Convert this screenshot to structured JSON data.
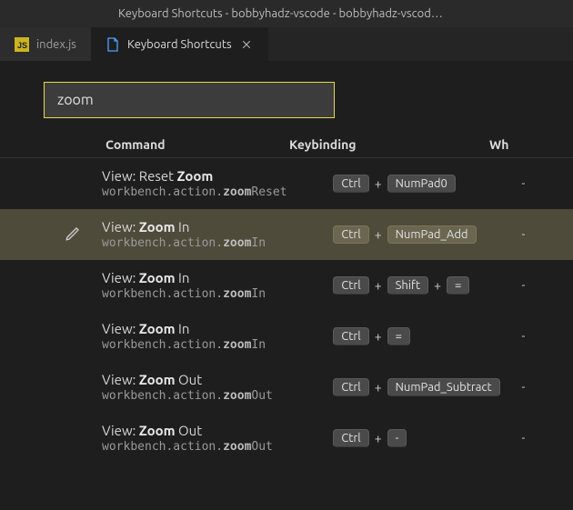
{
  "window": {
    "title": "Keyboard Shortcuts - bobbyhadz-vscode - bobbyhadz-vscod…"
  },
  "tabs": [
    {
      "label": "index.js",
      "icon": "js",
      "active": false,
      "close": false
    },
    {
      "label": "Keyboard Shortcuts",
      "icon": "file",
      "active": true,
      "close": true
    }
  ],
  "search": {
    "value": "zoom"
  },
  "columns": {
    "command": "Command",
    "keybinding": "Keybinding",
    "when": "Wh"
  },
  "rows": [
    {
      "title_pre": "View: Reset ",
      "title_hi": "Zoom",
      "title_post": "",
      "id_pre": "workbench.action.",
      "id_hi": "zoom",
      "id_post": "Reset",
      "k1": "Ctrl",
      "k2": "NumPad0",
      "k3": "",
      "when": "-",
      "selected": false
    },
    {
      "title_pre": "View: ",
      "title_hi": "Zoom",
      "title_post": " In",
      "id_pre": "workbench.action.",
      "id_hi": "zoom",
      "id_post": "In",
      "k1": "Ctrl",
      "k2": "NumPad_Add",
      "k3": "",
      "when": "-",
      "selected": true
    },
    {
      "title_pre": "View: ",
      "title_hi": "Zoom",
      "title_post": " In",
      "id_pre": "workbench.action.",
      "id_hi": "zoom",
      "id_post": "In",
      "k1": "Ctrl",
      "k2": "Shift",
      "k3": "=",
      "when": "-",
      "selected": false
    },
    {
      "title_pre": "View: ",
      "title_hi": "Zoom",
      "title_post": " In",
      "id_pre": "workbench.action.",
      "id_hi": "zoom",
      "id_post": "In",
      "k1": "Ctrl",
      "k2": "=",
      "k3": "",
      "when": "-",
      "selected": false
    },
    {
      "title_pre": "View: ",
      "title_hi": "Zoom",
      "title_post": " Out",
      "id_pre": "workbench.action.",
      "id_hi": "zoom",
      "id_post": "Out",
      "k1": "Ctrl",
      "k2": "NumPad_Subtract",
      "k3": "",
      "when": "-",
      "selected": false
    },
    {
      "title_pre": "View: ",
      "title_hi": "Zoom",
      "title_post": " Out",
      "id_pre": "workbench.action.",
      "id_hi": "zoom",
      "id_post": "Out",
      "k1": "Ctrl",
      "k2": "-",
      "k3": "",
      "when": "-",
      "selected": false
    }
  ]
}
